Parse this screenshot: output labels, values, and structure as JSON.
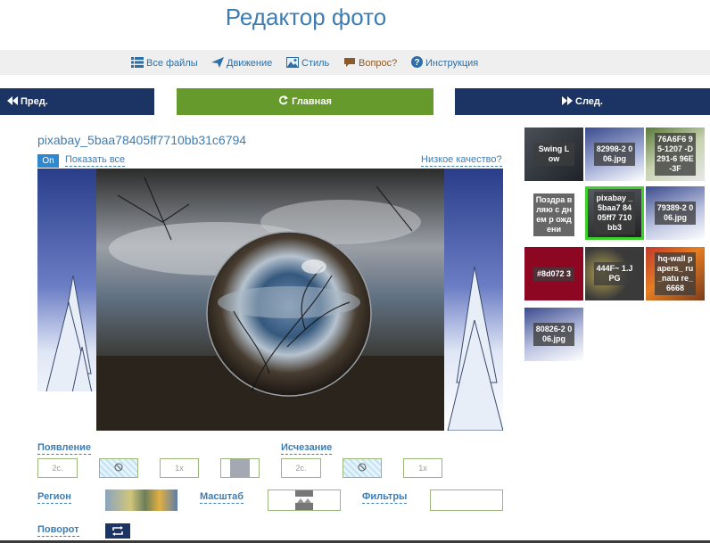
{
  "page": {
    "title": "Редактор фото"
  },
  "menu": {
    "items": [
      {
        "label": "Все файлы",
        "icon": "list-icon"
      },
      {
        "label": "Движение",
        "icon": "send-icon"
      },
      {
        "label": "Стиль",
        "icon": "image-icon"
      },
      {
        "label": "Вопрос?",
        "icon": "chat-icon"
      },
      {
        "label": "Инструкция",
        "icon": "help-icon"
      }
    ]
  },
  "nav": {
    "prev": "Пред.",
    "home": "Главная",
    "next": "След."
  },
  "photo": {
    "filename": "pixabay_5baa78405ff7710bb31c6794",
    "on_badge": "On",
    "show_all": "Показать все",
    "low_quality": "Низкое качество?"
  },
  "thumbnails": [
    {
      "caption": "Swing L ow"
    },
    {
      "caption": "82998-2 006.jpg"
    },
    {
      "caption": "76A6F6 95-1207 -D291-6 96E-3F"
    },
    {
      "caption": "Поздра вляю с днем р ождени"
    },
    {
      "caption": "pixabay _5baa7 8405ff7 710bb3",
      "selected": true
    },
    {
      "caption": "79389-2 006.jpg"
    },
    {
      "caption": "#8d072 3"
    },
    {
      "caption": "444F~ 1.JPG"
    },
    {
      "caption": "hq-wall papers_ ru_natu re_6668"
    },
    {
      "caption": "80826-2 006.jpg"
    }
  ],
  "controls": {
    "appear": {
      "label": "Появление",
      "duration": "2с.",
      "speed": "1x"
    },
    "disappear": {
      "label": "Исчезание",
      "duration": "2с.",
      "speed": "1x"
    },
    "region": {
      "label": "Регион"
    },
    "scale": {
      "label": "Масштаб"
    },
    "filters": {
      "label": "Фильтры"
    },
    "rotate": {
      "label": "Поворот"
    }
  },
  "colors": {
    "accent_blue": "#3d7db3",
    "nav_dark": "#1b3464",
    "nav_green": "#679a2c",
    "selected_green": "#3fd12b"
  }
}
